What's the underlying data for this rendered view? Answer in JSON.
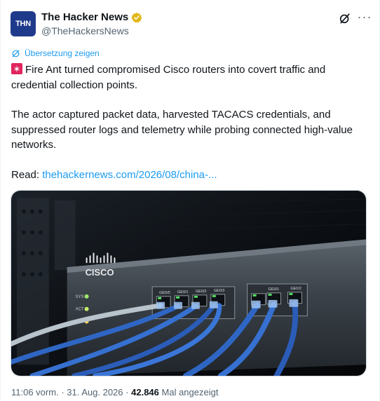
{
  "author": {
    "name": "The Hacker News",
    "handle": "@TheHackersNews",
    "avatar_text": "THN"
  },
  "translate_label": "Übersetzung zeigen",
  "tweet": {
    "line1": "Fire Ant turned compromised Cisco routers into covert traffic and credential collection points.",
    "line2": "The actor captured packet data, harvested TACACS credentials, and suppressed router logs and telemetry while probing connected high-value networks.",
    "read_prefix": "Read: ",
    "link_text": "thehackernews.com/2026/08/china-..."
  },
  "media": {
    "brand_text": "CISCO",
    "led_labels": [
      "SYS",
      "ACT",
      "PoE"
    ],
    "port_labels_left": [
      "GE0/0",
      "GE0/1",
      "GE0/2",
      "GE0/3"
    ],
    "port_labels_right": [
      "GE0/1",
      "GE0/2"
    ]
  },
  "footer": {
    "time": "11:06 vorm.",
    "separator": "·",
    "date": "31. Aug. 2026",
    "views_count": "42.846",
    "views_label": "Mal angezeigt"
  },
  "colors": {
    "link": "#1d9bf0",
    "verified_badge": "#e2b719",
    "avatar_bg": "#1f3a8a"
  },
  "icons": [
    "verified-badge-icon",
    "grok-icon",
    "more-icon",
    "translate-icon",
    "siren-emoji-icon"
  ]
}
